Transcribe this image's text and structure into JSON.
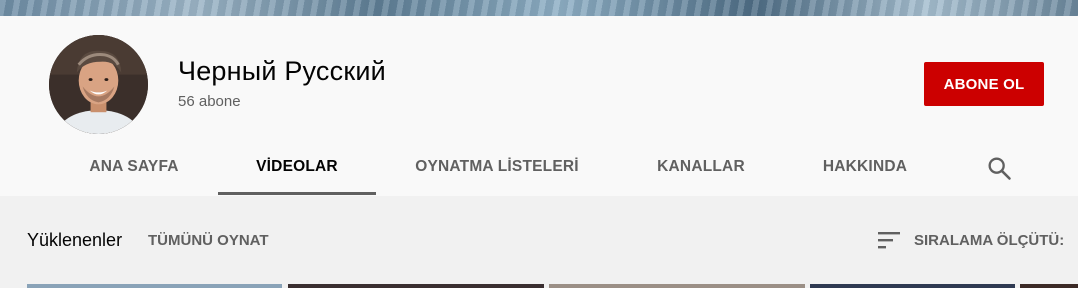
{
  "channel": {
    "name": "Черный Русский",
    "subscribers": "56 abone",
    "subscribe_label": "ABONE OL"
  },
  "tabs": [
    {
      "label": "ANA SAYFA",
      "active": false
    },
    {
      "label": "VİDEOLAR",
      "active": true
    },
    {
      "label": "OYNATMA LİSTELERİ",
      "active": false
    },
    {
      "label": "KANALLAR",
      "active": false
    },
    {
      "label": "HAKKINDA",
      "active": false
    }
  ],
  "icons": {
    "search": "search-icon",
    "sort": "sort-icon"
  },
  "uploads": {
    "title": "Yüklenenler",
    "play_all": "TÜMÜNÜ OYNAT",
    "sort_label": "SIRALAMA ÖLÇÜTÜ:"
  },
  "colors": {
    "subscribe_bg": "#cc0000",
    "header_bg": "#f9f9f9",
    "content_bg": "#f1f1f1",
    "active_tab_underline": "#606060"
  }
}
